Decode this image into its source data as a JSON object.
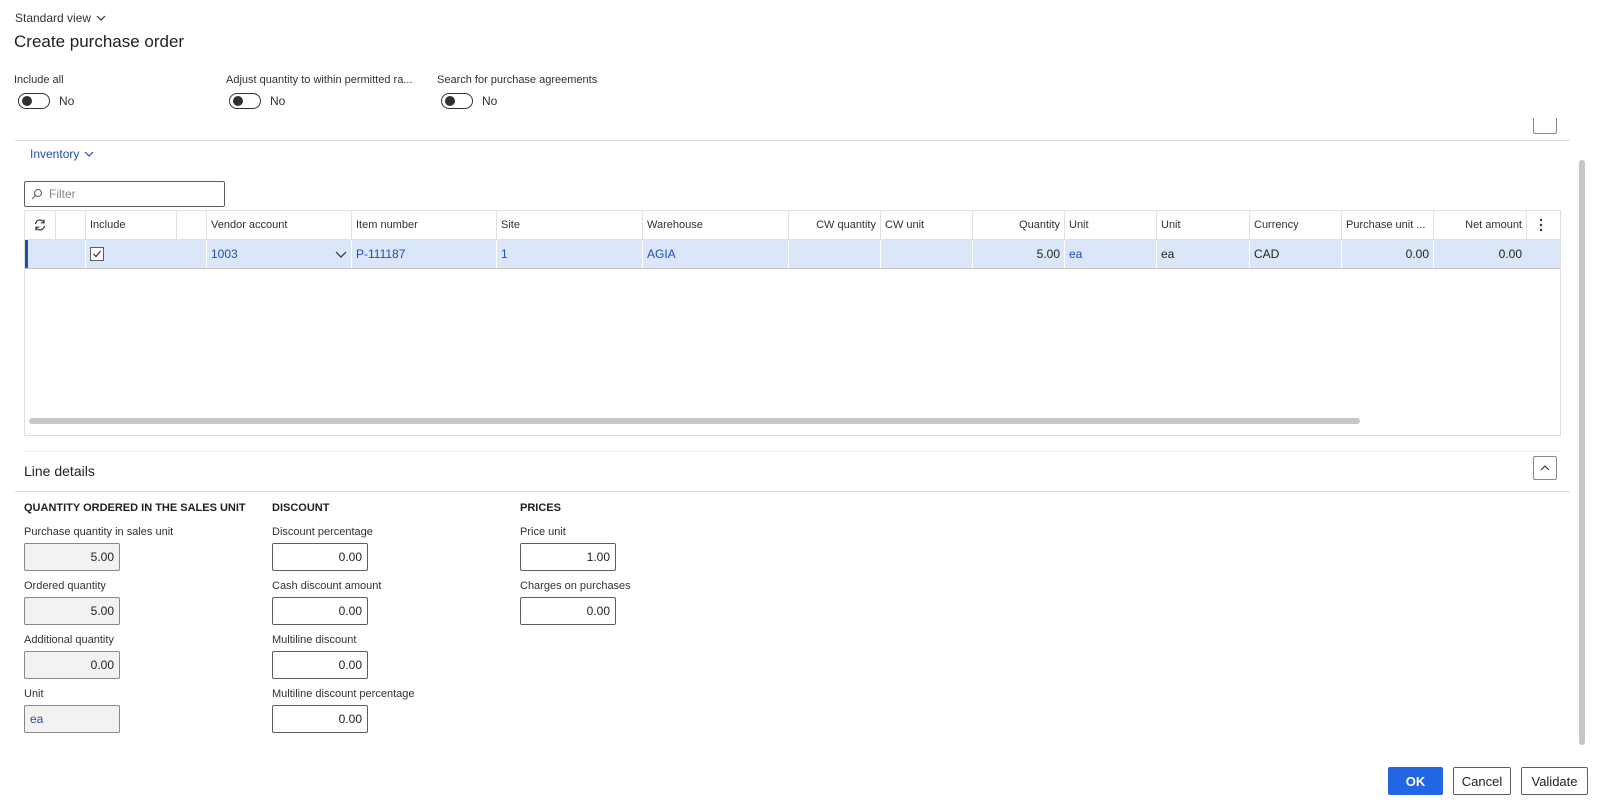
{
  "header": {
    "view_label": "Standard view",
    "title": "Create purchase order"
  },
  "toggles": [
    {
      "label": "Include all",
      "value": "No"
    },
    {
      "label": "Adjust quantity to within permitted ra...",
      "value": "No"
    },
    {
      "label": "Search for purchase agreements",
      "value": "No"
    }
  ],
  "inventory": {
    "label": "Inventory",
    "filter_placeholder": "Filter"
  },
  "grid": {
    "columns": [
      "Include",
      "Vendor account",
      "Item number",
      "Site",
      "Warehouse",
      "CW quantity",
      "CW unit",
      "Quantity",
      "Unit",
      "Unit",
      "Currency",
      "Purchase unit ...",
      "Net amount"
    ],
    "row": {
      "vendor_account": "1003",
      "item_number": "P-111187",
      "site": "1",
      "warehouse": "AGIA",
      "cw_quantity": "",
      "cw_unit": "",
      "quantity": "5.00",
      "unit1": "ea",
      "unit2": "ea",
      "currency": "CAD",
      "purchase_unit": "0.00",
      "net_amount": "0.00"
    }
  },
  "line_details": {
    "title": "Line details",
    "qty_section": {
      "heading": "QUANTITY ORDERED IN THE SALES UNIT",
      "fields": [
        {
          "label": "Purchase quantity in sales unit",
          "value": "5.00"
        },
        {
          "label": "Ordered quantity",
          "value": "5.00"
        },
        {
          "label": "Additional quantity",
          "value": "0.00"
        },
        {
          "label": "Unit",
          "value": "ea"
        }
      ]
    },
    "discount_section": {
      "heading": "DISCOUNT",
      "fields": [
        {
          "label": "Discount percentage",
          "value": "0.00"
        },
        {
          "label": "Cash discount amount",
          "value": "0.00"
        },
        {
          "label": "Multiline discount",
          "value": "0.00"
        },
        {
          "label": "Multiline discount percentage",
          "value": "0.00"
        }
      ]
    },
    "prices_section": {
      "heading": "PRICES",
      "fields": [
        {
          "label": "Price unit",
          "value": "1.00"
        },
        {
          "label": "Charges on purchases",
          "value": "0.00"
        }
      ]
    }
  },
  "buttons": {
    "ok": "OK",
    "cancel": "Cancel",
    "validate": "Validate"
  }
}
